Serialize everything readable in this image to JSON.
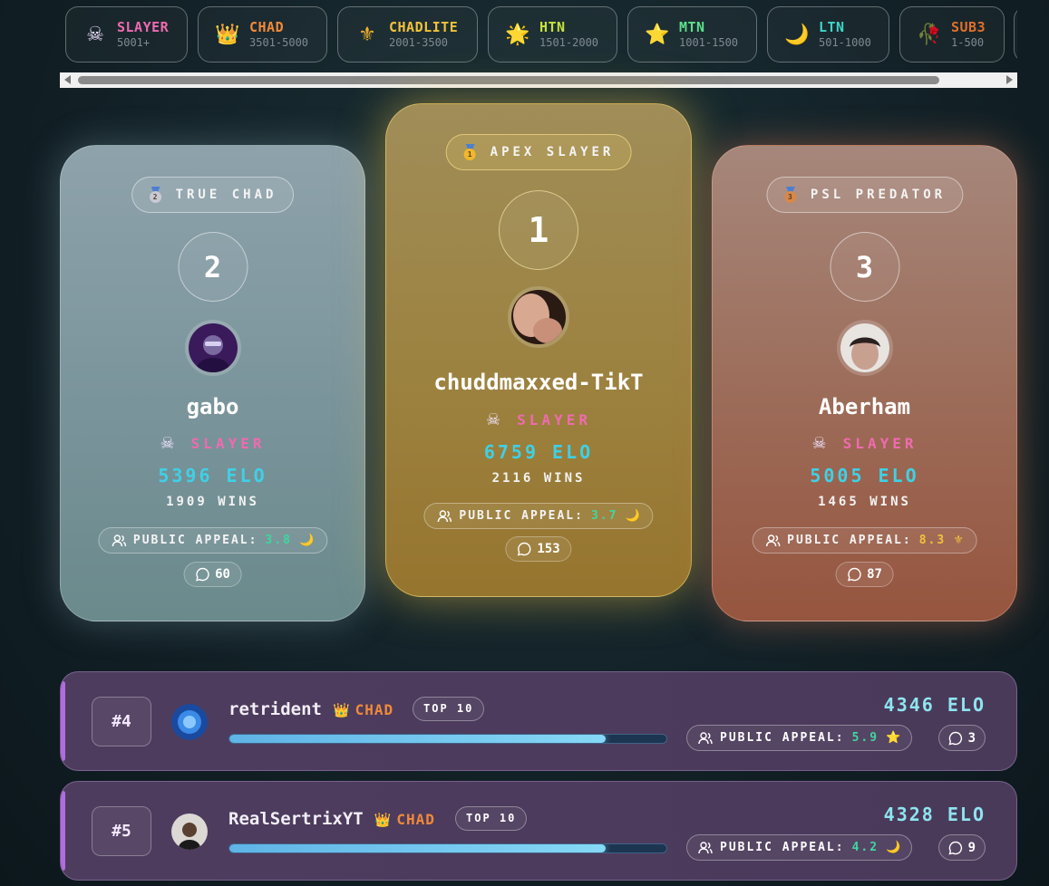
{
  "tiers": [
    {
      "name": "SLAYER",
      "range": "5001+",
      "icon": "☠",
      "color": "#f06ab0",
      "icon_color": "#f0e2ff"
    },
    {
      "name": "CHAD",
      "range": "3501-5000",
      "icon": "👑",
      "color": "#f08a3a",
      "icon_color": "#f0a23a"
    },
    {
      "name": "CHADLITE",
      "range": "2001-3500",
      "icon": "⚜",
      "color": "#f2c23a",
      "icon_color": "#f2b22a"
    },
    {
      "name": "HTN",
      "range": "1501-2000",
      "icon": "🌟",
      "color": "#c8e23a",
      "icon_color": "#f2c22a"
    },
    {
      "name": "MTN",
      "range": "1001-1500",
      "icon": "⭐",
      "color": "#5ee08a",
      "icon_color": "#f2c22a"
    },
    {
      "name": "LTN",
      "range": "501-1000",
      "icon": "🌙",
      "color": "#3ed6c8",
      "icon_color": "#f2c23a"
    },
    {
      "name": "SUB3",
      "range": "1-500",
      "icon": "🥀",
      "color": "#e0702a",
      "icon_color": "#c03040"
    }
  ],
  "podium": [
    {
      "place": "2",
      "badge": "TRUE CHAD",
      "medal": "2",
      "name": "gabo",
      "tier_icon": "☠",
      "tier": "SLAYER",
      "elo": "5396 ELO",
      "wins": "1909 WINS",
      "appeal_label": "PUBLIC APPEAL:",
      "appeal_value": "3.8",
      "appeal_color": "#3fd6a0",
      "appeal_emoji": "🌙",
      "comments": "60"
    },
    {
      "place": "1",
      "badge": "APEX SLAYER",
      "medal": "1",
      "name": "chuddmaxxed-TikT",
      "tier_icon": "☠",
      "tier": "SLAYER",
      "elo": "6759 ELO",
      "wins": "2116 WINS",
      "appeal_label": "PUBLIC APPEAL:",
      "appeal_value": "3.7",
      "appeal_color": "#3fd6a0",
      "appeal_emoji": "🌙",
      "comments": "153"
    },
    {
      "place": "3",
      "badge": "PSL PREDATOR",
      "medal": "3",
      "name": "Aberham",
      "tier_icon": "☠",
      "tier": "SLAYER",
      "elo": "5005 ELO",
      "wins": "1465 WINS",
      "appeal_label": "PUBLIC APPEAL:",
      "appeal_value": "8.3",
      "appeal_color": "#f2c23a",
      "appeal_emoji": "⚜",
      "comments": "87"
    }
  ],
  "rows": [
    {
      "rank": "#4",
      "name": "retrident",
      "tier_icon": "👑",
      "tier": "CHAD",
      "tag": "TOP 10",
      "elo": "4346 ELO",
      "progress": 0.86,
      "appeal_label": "PUBLIC APPEAL:",
      "appeal_value": "5.9",
      "appeal_emoji": "⭐",
      "comments": "3"
    },
    {
      "rank": "#5",
      "name": "RealSertrixYT",
      "tier_icon": "👑",
      "tier": "CHAD",
      "tag": "TOP 10",
      "elo": "4328 ELO",
      "progress": 0.86,
      "appeal_label": "PUBLIC APPEAL:",
      "appeal_value": "4.2",
      "appeal_emoji": "🌙",
      "comments": "9"
    }
  ]
}
